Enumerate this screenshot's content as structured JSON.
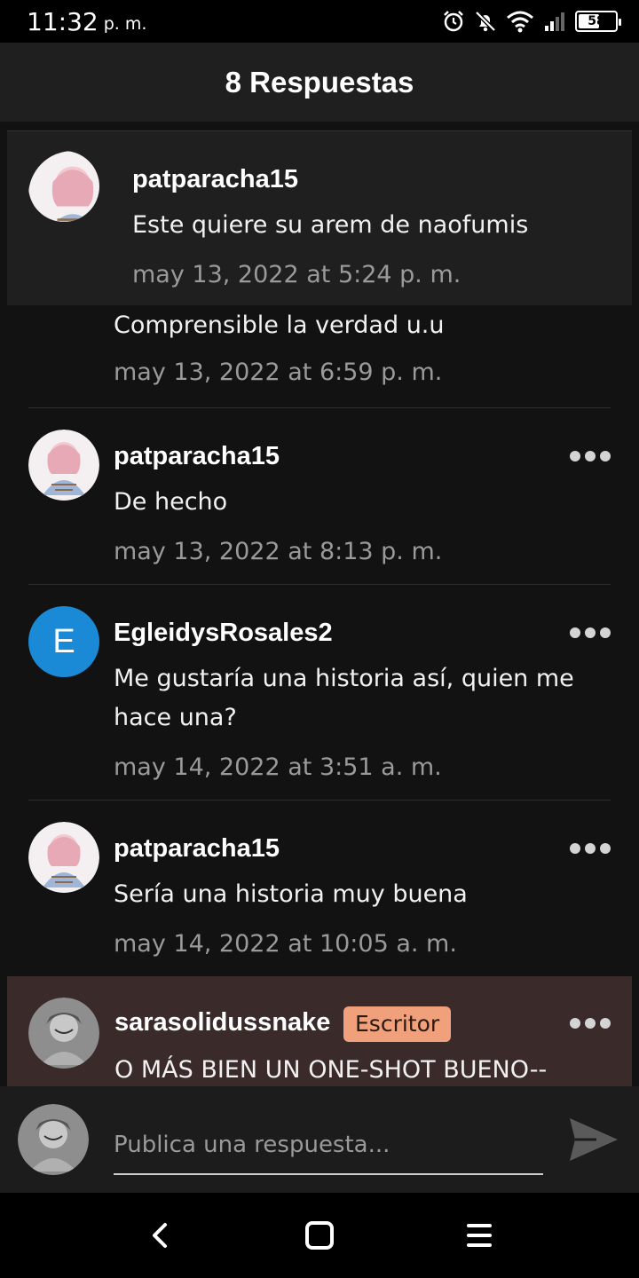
{
  "status_bar": {
    "time": "11:32",
    "ampm": "p. m.",
    "battery": "58",
    "battery_level": 0.58
  },
  "header": {
    "title": "8 Respuestas"
  },
  "comments": [
    {
      "username": "patparacha15",
      "text": "Este quiere su arem de naofumis",
      "timestamp": "may 13, 2022 at 5:24 p. m."
    },
    {
      "username": "",
      "text": "Comprensible la verdad u.u",
      "timestamp": "may 13, 2022 at 6:59 p. m."
    },
    {
      "username": "patparacha15",
      "text": "De hecho",
      "timestamp": "may 13, 2022 at 8:13 p. m."
    },
    {
      "username": "EgleidysRosales2",
      "avatar_letter": "E",
      "avatar_color": "#1a8ad6",
      "text": "Me gustaría una historia así,  quien me hace una?",
      "timestamp": "may 14, 2022 at 3:51 a. m."
    },
    {
      "username": "patparacha15",
      "text": "Sería una historia muy buena",
      "timestamp": "may 14, 2022 at 10:05 a. m."
    },
    {
      "username": "sarasolidussnake",
      "badge": "Escritor",
      "badge_color": "#f0a07a",
      "text": "O MÁS BIEN UN ONE-SHOT BUENO--"
    }
  ],
  "reply": {
    "placeholder": "Publica una respuesta..."
  },
  "icons": {
    "alarm": "alarm-icon",
    "mute": "notifications-off-icon",
    "wifi": "wifi-icon",
    "signal": "signal-icon",
    "more": "more-horizontal-icon",
    "send": "send-icon",
    "back": "back-icon",
    "home": "home-icon",
    "menu": "menu-icon"
  }
}
